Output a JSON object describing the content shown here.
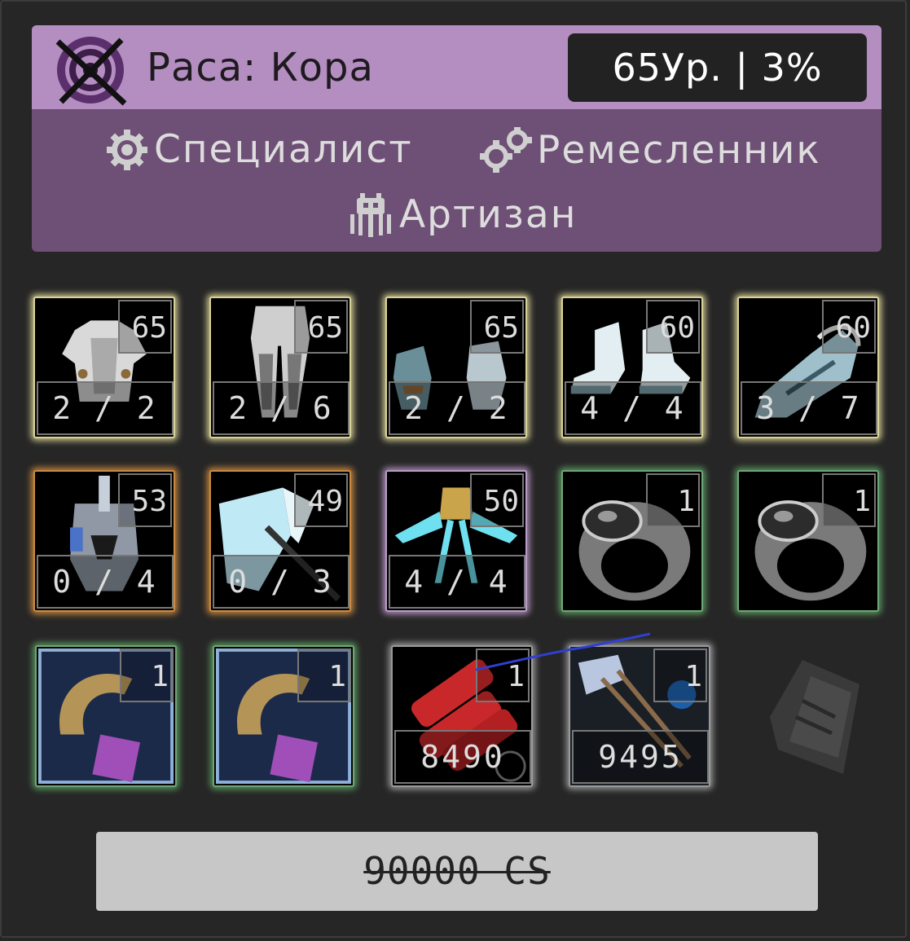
{
  "header": {
    "race_label": "Раса: Кора",
    "level_text": "65Ур. | 3%"
  },
  "classes": [
    {
      "label": "Специалист",
      "icon": "gear-icon"
    },
    {
      "label": "Ремесленник",
      "icon": "crafting-gears-icon"
    },
    {
      "label": "Артизан",
      "icon": "artisan-icon"
    }
  ],
  "items": [
    {
      "icon": "chest-armor-icon",
      "level": "65",
      "count": "2 / 2",
      "rarity": "gold"
    },
    {
      "icon": "leg-armor-icon",
      "level": "65",
      "count": "2 / 6",
      "rarity": "gold"
    },
    {
      "icon": "gloves-icon",
      "level": "65",
      "count": "2 / 2",
      "rarity": "gold"
    },
    {
      "icon": "boots-icon",
      "level": "60",
      "count": "4 / 4",
      "rarity": "gold"
    },
    {
      "icon": "boots-icon",
      "level": "60",
      "count": "3 / 7",
      "rarity": "gold"
    },
    {
      "icon": "helmet-icon",
      "level": "53",
      "count": "0 / 4",
      "rarity": "orange"
    },
    {
      "icon": "axe-icon",
      "level": "49",
      "count": "0 / 3",
      "rarity": "orange"
    },
    {
      "icon": "wings-icon",
      "level": "50",
      "count": "4 / 4",
      "rarity": "lilac"
    },
    {
      "icon": "ring-icon",
      "level": "1",
      "count": "",
      "rarity": "green"
    },
    {
      "icon": "ring-icon",
      "level": "1",
      "count": "",
      "rarity": "green"
    },
    {
      "icon": "earring-icon",
      "level": "1",
      "count": "",
      "rarity": "green"
    },
    {
      "icon": "earring-icon",
      "level": "1",
      "count": "",
      "rarity": "green"
    },
    {
      "icon": "ammo-icon",
      "level": "1",
      "count": "8490",
      "rarity": "white"
    },
    {
      "icon": "arrows-icon",
      "level": "1",
      "count": "9495",
      "rarity": "white"
    }
  ],
  "price": "90000 CS"
}
